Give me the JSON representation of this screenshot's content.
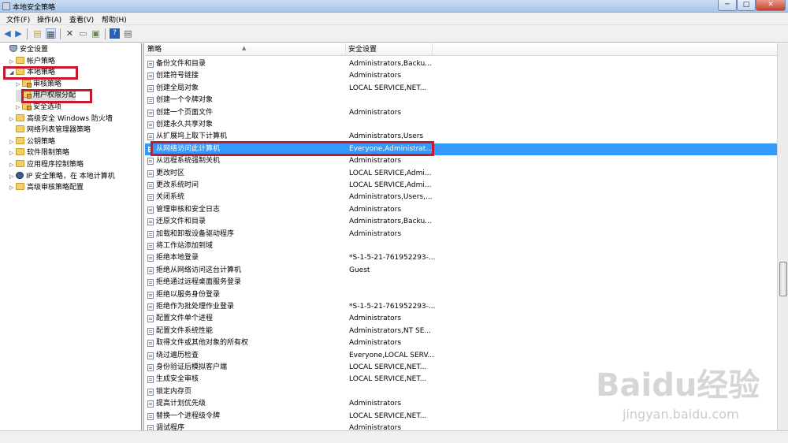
{
  "window": {
    "title": "本地安全策略",
    "min": "─",
    "max": "□",
    "close": "✕"
  },
  "menu": [
    "文件(F)",
    "操作(A)",
    "查看(V)",
    "帮助(H)"
  ],
  "toolbar": {
    "icons": [
      "back-icon",
      "forward-icon",
      "up-folder-icon",
      "show-tree-icon",
      "delete-icon",
      "properties-icon",
      "export-icon",
      "help-icon",
      "view-icon"
    ]
  },
  "tree": [
    {
      "label": "安全设置",
      "icon": "shield-icon",
      "arrow": "",
      "indent": 0
    },
    {
      "label": "帐户策略",
      "icon": "folder-icon",
      "arrow": "▷",
      "indent": 1
    },
    {
      "label": "本地策略",
      "icon": "folder-icon",
      "arrow": "◢",
      "indent": 1
    },
    {
      "label": "审核策略",
      "icon": "lock-folder-icon",
      "arrow": "▷",
      "indent": 2
    },
    {
      "label": "用户权限分配",
      "icon": "lock-folder-icon",
      "arrow": "",
      "indent": 2,
      "selected": true
    },
    {
      "label": "安全选项",
      "icon": "lock-folder-icon",
      "arrow": "▷",
      "indent": 2
    },
    {
      "label": "高级安全 Windows 防火墙",
      "icon": "folder-icon",
      "arrow": "▷",
      "indent": 1
    },
    {
      "label": "网络列表管理器策略",
      "icon": "folder-icon",
      "arrow": "",
      "indent": 1
    },
    {
      "label": "公钥策略",
      "icon": "folder-icon",
      "arrow": "▷",
      "indent": 1
    },
    {
      "label": "软件限制策略",
      "icon": "folder-icon",
      "arrow": "▷",
      "indent": 1
    },
    {
      "label": "应用程序控制策略",
      "icon": "folder-icon",
      "arrow": "▷",
      "indent": 1
    },
    {
      "label": "IP 安全策略，在 本地计算机",
      "icon": "ipsec-icon",
      "arrow": "▷",
      "indent": 1
    },
    {
      "label": "高级审核策略配置",
      "icon": "folder-icon",
      "arrow": "▷",
      "indent": 1
    }
  ],
  "list": {
    "headers": {
      "policy": "策略",
      "setting": "安全设置"
    },
    "rows": [
      {
        "policy": "备份文件和目录",
        "setting": "Administrators,Backu..."
      },
      {
        "policy": "创建符号链接",
        "setting": "Administrators"
      },
      {
        "policy": "创建全局对象",
        "setting": "LOCAL SERVICE,NET..."
      },
      {
        "policy": "创建一个令牌对象",
        "setting": ""
      },
      {
        "policy": "创建一个页面文件",
        "setting": "Administrators"
      },
      {
        "policy": "创建永久共享对象",
        "setting": ""
      },
      {
        "policy": "从扩展坞上取下计算机",
        "setting": "Administrators,Users"
      },
      {
        "policy": "从网络访问此计算机",
        "setting": "Everyone,Administrat...",
        "selected": true
      },
      {
        "policy": "从远程系统强制关机",
        "setting": "Administrators"
      },
      {
        "policy": "更改时区",
        "setting": "LOCAL SERVICE,Admi..."
      },
      {
        "policy": "更改系统时间",
        "setting": "LOCAL SERVICE,Admi..."
      },
      {
        "policy": "关闭系统",
        "setting": "Administrators,Users,..."
      },
      {
        "policy": "管理审核和安全日志",
        "setting": "Administrators"
      },
      {
        "policy": "还原文件和目录",
        "setting": "Administrators,Backu..."
      },
      {
        "policy": "加载和卸载设备驱动程序",
        "setting": "Administrators"
      },
      {
        "policy": "将工作站添加到域",
        "setting": ""
      },
      {
        "policy": "拒绝本地登录",
        "setting": "*S-1-5-21-761952293-..."
      },
      {
        "policy": "拒绝从网络访问这台计算机",
        "setting": "Guest"
      },
      {
        "policy": "拒绝通过远程桌面服务登录",
        "setting": ""
      },
      {
        "policy": "拒绝以服务身份登录",
        "setting": ""
      },
      {
        "policy": "拒绝作为批处理作业登录",
        "setting": "*S-1-5-21-761952293-..."
      },
      {
        "policy": "配置文件单个进程",
        "setting": "Administrators"
      },
      {
        "policy": "配置文件系统性能",
        "setting": "Administrators,NT SE..."
      },
      {
        "policy": "取得文件或其他对象的所有权",
        "setting": "Administrators"
      },
      {
        "policy": "绕过遍历检查",
        "setting": "Everyone,LOCAL SERV..."
      },
      {
        "policy": "身份验证后模拟客户端",
        "setting": "LOCAL SERVICE,NET..."
      },
      {
        "policy": "生成安全审核",
        "setting": "LOCAL SERVICE,NET..."
      },
      {
        "policy": "锁定内存页",
        "setting": ""
      },
      {
        "policy": "提高计划优先级",
        "setting": "Administrators"
      },
      {
        "policy": "替换一个进程级令牌",
        "setting": "LOCAL SERVICE,NET..."
      },
      {
        "policy": "调试程序",
        "setting": "Administrators"
      }
    ]
  },
  "scroll": {
    "position": 0.62,
    "thumb_fraction": 0.09
  },
  "watermark": {
    "logo": "Bai⁠du经验",
    "url": "jingyan.baidu.com"
  },
  "colors": {
    "selection": "#3399ff",
    "annotation": "#c6182f"
  }
}
